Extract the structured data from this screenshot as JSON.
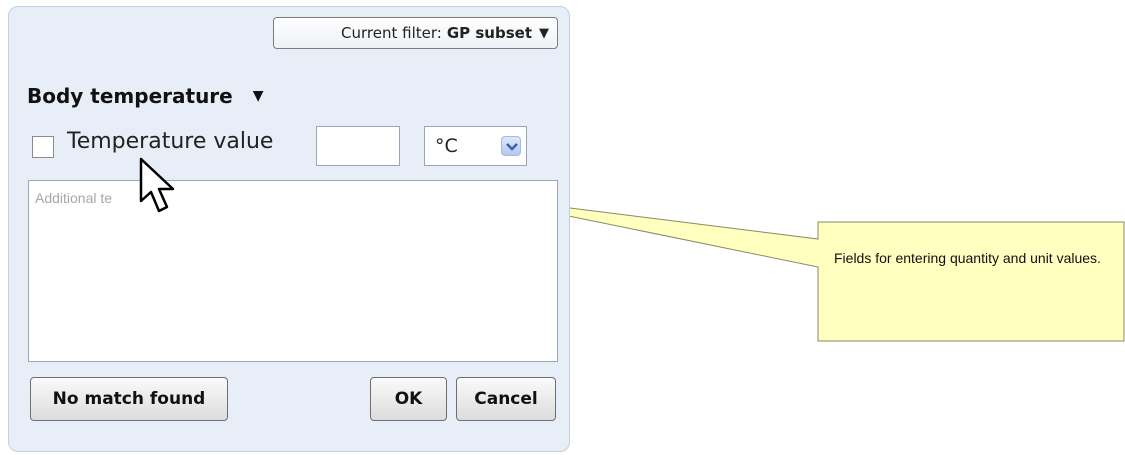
{
  "filter": {
    "prefix": "Current filter:",
    "value": "GP subset",
    "arrow_icon": "triangle-down-icon"
  },
  "section": {
    "title": "Body temperature",
    "toggle_icon": "triangle-down-icon"
  },
  "temperature": {
    "label": "Temperature value",
    "value": "",
    "unit_selected": "°C",
    "checked": false
  },
  "notes": {
    "placeholder": "Additional te"
  },
  "buttons": {
    "no_match": "No match found",
    "ok": "OK",
    "cancel": "Cancel"
  },
  "callout": {
    "text": "Fields for entering quantity and unit values."
  },
  "colors": {
    "panel_background": "#e8eef7",
    "callout_background": "#ffffc0"
  }
}
